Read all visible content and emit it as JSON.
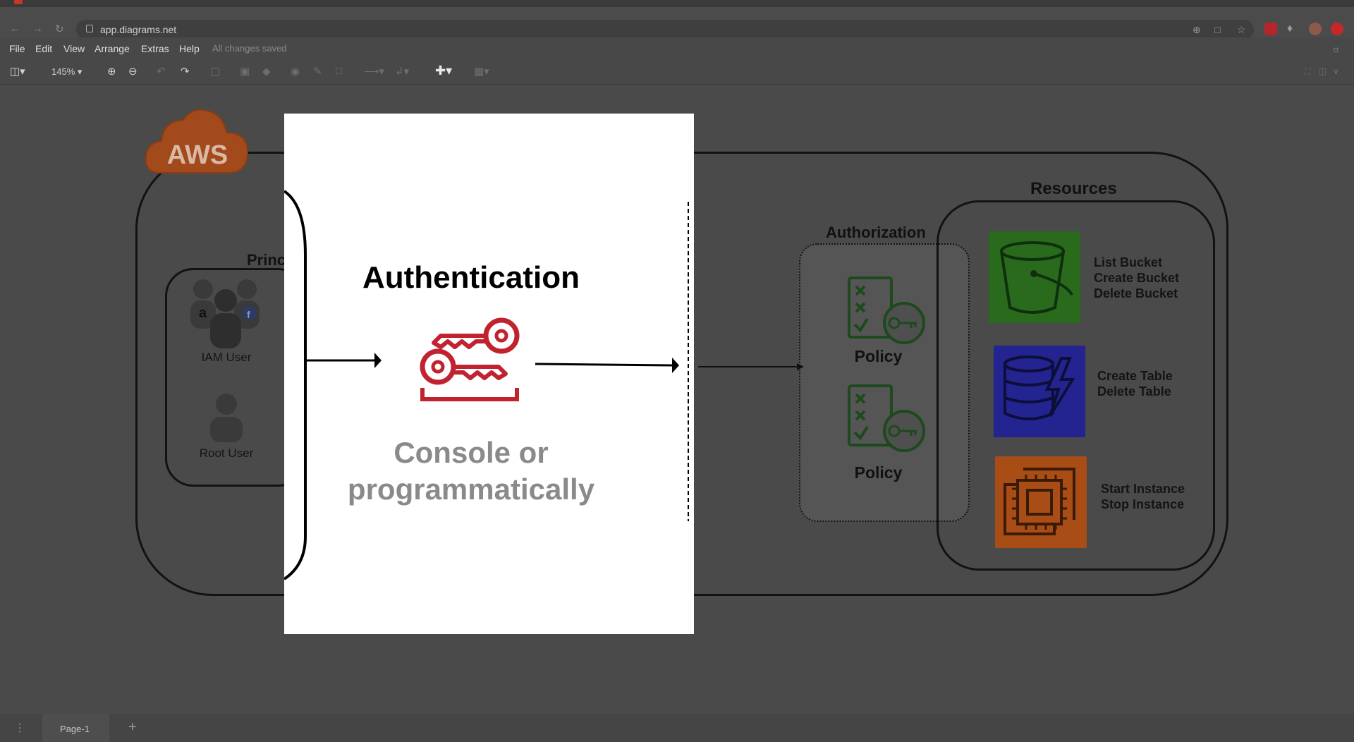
{
  "browser": {
    "url": "app.diagrams.net"
  },
  "menubar": {
    "items": [
      "File",
      "Edit",
      "View",
      "Arrange",
      "Extras",
      "Help"
    ],
    "status": "All changes saved"
  },
  "toolbar": {
    "zoom": "145%"
  },
  "diagram": {
    "aws_label": "AWS",
    "principals_title": "Princ",
    "iam_user": "IAM User",
    "root_user": "Root User",
    "authorization_title": "Authorization",
    "policy_1": "Policy",
    "policy_2": "Policy",
    "resources_title": "Resources",
    "s3_actions": [
      "List Bucket",
      "Create Bucket",
      "Delete Bucket"
    ],
    "dynamo_actions": [
      "Create Table",
      "Delete Table"
    ],
    "ec2_actions": [
      "Start Instance",
      "Stop Instance"
    ],
    "colors": {
      "aws_orange": "#c0551f",
      "s3_green": "#2d7d1f",
      "dynamo_blue": "#2c2ea0",
      "ec2_orange": "#c55a17",
      "policy_green": "#1f5a1f",
      "key_red": "#c0232f"
    }
  },
  "popup": {
    "title": "Authentication",
    "subtitle_line1": "Console or",
    "subtitle_line2": "programmatically"
  },
  "pagebar": {
    "page_label": "Page-1"
  }
}
